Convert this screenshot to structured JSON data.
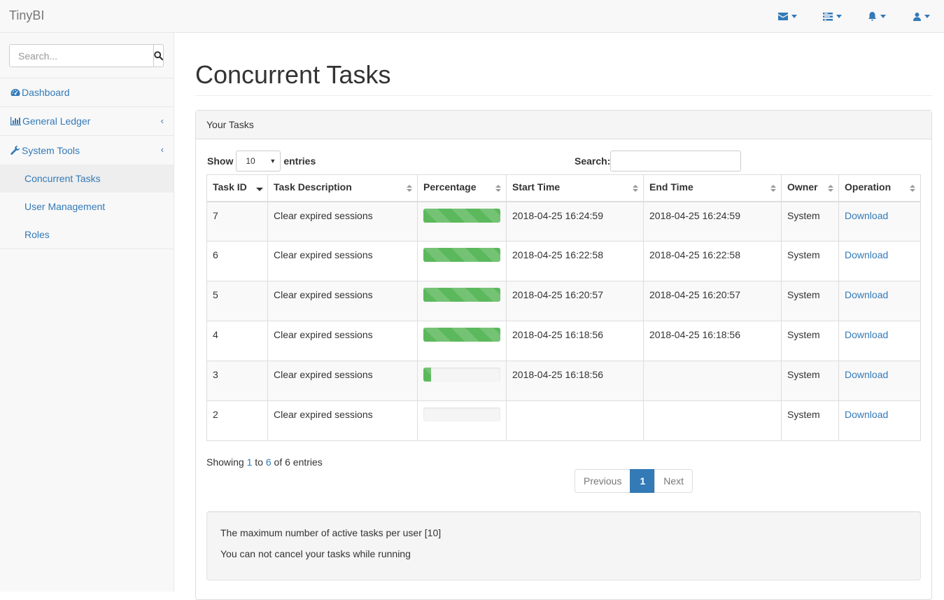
{
  "app": {
    "brand": "TinyBI"
  },
  "navbar": {
    "icons": [
      "envelope-icon",
      "tasks-icon",
      "bell-icon",
      "user-icon"
    ]
  },
  "sidebar": {
    "search_placeholder": "Search...",
    "items": [
      {
        "label": "Dashboard",
        "icon": "dashboard-icon"
      },
      {
        "label": "General Ledger",
        "icon": "bar-chart-icon"
      },
      {
        "label": "System Tools",
        "icon": "wrench-icon"
      }
    ],
    "sub_items": [
      {
        "label": "Concurrent Tasks",
        "active": true
      },
      {
        "label": "User Management",
        "active": false
      },
      {
        "label": "Roles",
        "active": false
      }
    ]
  },
  "page": {
    "title": "Concurrent Tasks"
  },
  "panel": {
    "heading": "Your Tasks"
  },
  "table_controls": {
    "show_label": "Show",
    "entries_value": "10",
    "entries_label": "entries",
    "search_label": "Search:"
  },
  "table": {
    "columns": [
      "Task ID",
      "Task Description",
      "Percentage",
      "Start Time",
      "End Time",
      "Owner",
      "Operation"
    ],
    "rows": [
      {
        "id": "7",
        "description": "Clear expired sessions",
        "percentage": 100,
        "start": "2018-04-25 16:24:59",
        "end": "2018-04-25 16:24:59",
        "owner": "System",
        "operation": "Download"
      },
      {
        "id": "6",
        "description": "Clear expired sessions",
        "percentage": 100,
        "start": "2018-04-25 16:22:58",
        "end": "2018-04-25 16:22:58",
        "owner": "System",
        "operation": "Download"
      },
      {
        "id": "5",
        "description": "Clear expired sessions",
        "percentage": 100,
        "start": "2018-04-25 16:20:57",
        "end": "2018-04-25 16:20:57",
        "owner": "System",
        "operation": "Download"
      },
      {
        "id": "4",
        "description": "Clear expired sessions",
        "percentage": 100,
        "start": "2018-04-25 16:18:56",
        "end": "2018-04-25 16:18:56",
        "owner": "System",
        "operation": "Download"
      },
      {
        "id": "3",
        "description": "Clear expired sessions",
        "percentage": 10,
        "start": "2018-04-25 16:18:56",
        "end": "",
        "owner": "System",
        "operation": "Download"
      },
      {
        "id": "2",
        "description": "Clear expired sessions",
        "percentage": 0,
        "start": "",
        "end": "",
        "owner": "System",
        "operation": "Download"
      }
    ]
  },
  "info": {
    "prefix": "Showing ",
    "start": "1",
    "middle": " to ",
    "end": "6",
    "suffix": " of 6 entries"
  },
  "pagination": {
    "previous": "Previous",
    "current": "1",
    "next": "Next"
  },
  "notes": {
    "line1": "The maximum number of active tasks per user [10]",
    "line2": "You can not cancel your tasks while running"
  },
  "colors": {
    "accent": "#337ab7",
    "progress": "#5cb85c"
  }
}
